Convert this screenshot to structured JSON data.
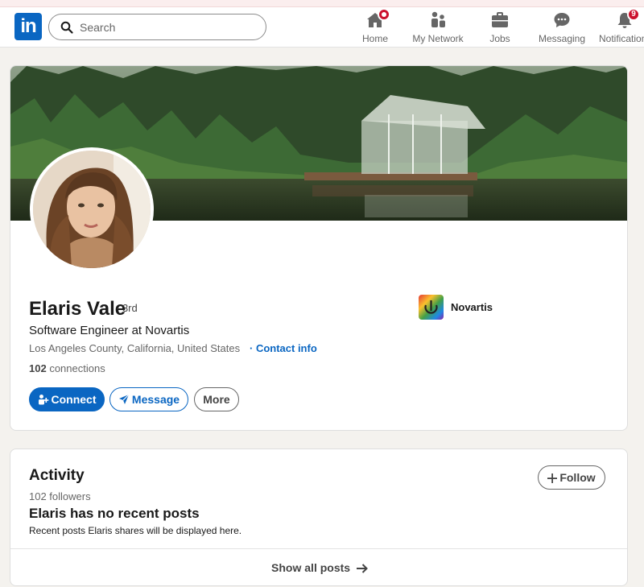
{
  "brand": {
    "logo_text": "in",
    "accent": "#0a66c2"
  },
  "search": {
    "placeholder": "Search",
    "icon": "search-icon"
  },
  "nav": [
    {
      "label": "Home",
      "icon": "home-icon",
      "badge": ""
    },
    {
      "label": "My Network",
      "icon": "people-icon",
      "badge": null
    },
    {
      "label": "Jobs",
      "icon": "briefcase-icon",
      "badge": null
    },
    {
      "label": "Messaging",
      "icon": "chat-icon",
      "badge": null
    },
    {
      "label": "Notifications",
      "icon": "bell-icon",
      "badge": "9"
    }
  ],
  "profile": {
    "name": "Elaris Vale",
    "degree": "· 3rd",
    "headline": "Software Engineer at Novartis",
    "location": "Los Angeles County, California, United States",
    "contact_label": "· Contact info",
    "connections_count": "102",
    "connections_label": "connections",
    "company": "Novartis",
    "actions": {
      "connect": "Connect",
      "message": "Message",
      "more": "More"
    }
  },
  "activity": {
    "title": "Activity",
    "followers": "102 followers",
    "follow_label": "Follow",
    "empty_title": "Elaris has no recent posts",
    "empty_desc": "Recent posts Elaris shares will be displayed here.",
    "show_all": "Show all posts"
  }
}
